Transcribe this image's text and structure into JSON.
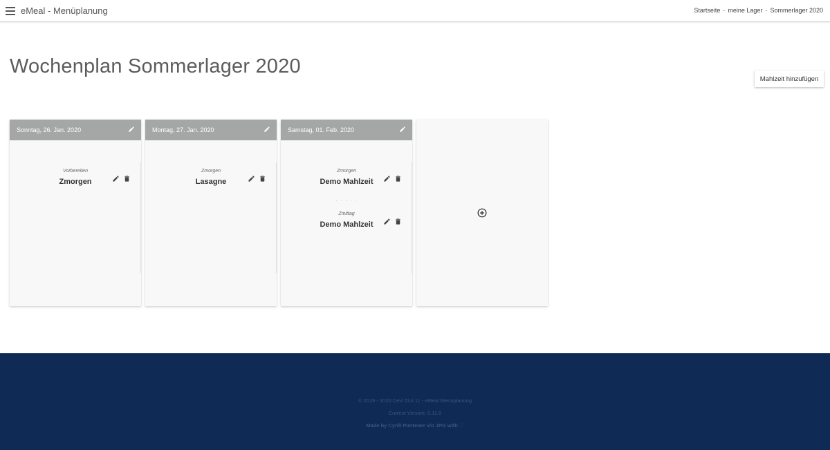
{
  "app": {
    "title": "eMeal - Menüplanung"
  },
  "breadcrumb": {
    "items": [
      "Startseite",
      "meine Lager",
      "Sommerlager 2020"
    ],
    "separator": "-"
  },
  "page": {
    "title": "Wochenplan Sommerlager 2020",
    "add_meal_label": "Mahlzeit hinzufügen"
  },
  "days": [
    {
      "date": "Sonntag, 26. Jan. 2020",
      "meals": [
        {
          "type": "Vorbereiten",
          "name": "Zmorgen"
        }
      ]
    },
    {
      "date": "Montag, 27. Jan. 2020",
      "meals": [
        {
          "type": "Zmorgen",
          "name": "Lasagne"
        }
      ]
    },
    {
      "date": "Samstag, 01. Feb. 2020",
      "meals": [
        {
          "type": "Zmorgen",
          "name": "Demo Mahlzeit"
        },
        {
          "type": "Zmittag",
          "name": "Demo Mahlzeit"
        }
      ],
      "separator": "· · · · ·"
    }
  ],
  "footer": {
    "copyright": "© 2019 - 2020 Cevi Züri 11 - eMeal Menüplanung",
    "version": "Current Version: 0.11.0",
    "made_by": "Made by Cyrill Püntener v/o JPG with ♡"
  },
  "icons": {
    "menu": "menu-icon",
    "edit": "pencil-icon",
    "delete": "trash-icon",
    "add": "plus-circle-icon"
  },
  "colors": {
    "header_grey": "#a4a7a6",
    "footer_navy": "#0e2a55",
    "card_bg": "#f8f8f8"
  }
}
